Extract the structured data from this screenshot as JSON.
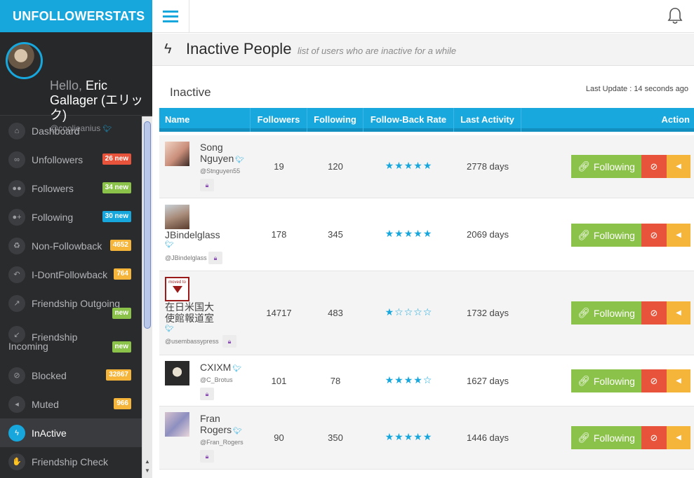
{
  "brand": "UNFOLLOWERSTATS",
  "colors": {
    "accent": "#17a7dc",
    "sidebar": "#2a2b2d",
    "follow": "#8bc34a",
    "block": "#e8543b",
    "mute": "#f5b43a"
  },
  "profile": {
    "hello": "Hello,",
    "name": "Eric Gallager (エリック)",
    "handle": "@cooljeanius"
  },
  "menu": [
    {
      "label": "Dashboard",
      "icon": "home-icon",
      "badge": "",
      "badge_color": ""
    },
    {
      "label": "Unfollowers",
      "icon": "unlink-icon",
      "badge": "26 new",
      "badge_color": "#e8543b"
    },
    {
      "label": "Followers",
      "icon": "users-icon",
      "badge": "34 new",
      "badge_color": "#8bc34a"
    },
    {
      "label": "Following",
      "icon": "user-plus-icon",
      "badge": "30 new",
      "badge_color": "#17a7dc"
    },
    {
      "label": "Non-Followback",
      "icon": "recycle-icon",
      "badge": "4652",
      "badge_color": "#f5b43a"
    },
    {
      "label": "I-DontFollowback",
      "icon": "reply-icon",
      "badge": "764",
      "badge_color": "#f5b43a"
    },
    {
      "label": "Friendship Outgoing",
      "icon": "outgoing-icon",
      "badge": "",
      "badge_color": ""
    },
    {
      "label": "Friendship",
      "label2": "Incoming",
      "icon": "incoming-icon",
      "badge": "new",
      "badge2": "new",
      "badge_color": "#8bc34a"
    },
    {
      "label": "Blocked",
      "icon": "ban-icon",
      "badge": "32867",
      "badge_color": "#f5b43a"
    },
    {
      "label": "Muted",
      "icon": "volume-off-icon",
      "badge": "966",
      "badge_color": "#f5b43a"
    },
    {
      "label": "InActive",
      "icon": "bolt-icon",
      "badge": "",
      "badge_color": ""
    },
    {
      "label": "Friendship Check",
      "icon": "handshake-icon",
      "badge": "",
      "badge_color": ""
    }
  ],
  "page": {
    "title": "Inactive People",
    "subtitle": "list of users who are inactive for a while"
  },
  "panel": {
    "title": "Inactive",
    "last_update": "Last Update : 14 seconds ago"
  },
  "table": {
    "headers": {
      "name": "Name",
      "followers": "Followers",
      "following": "Following",
      "rate": "Follow-Back Rate",
      "activity": "Last Activity",
      "action": "Action"
    },
    "rows": [
      {
        "name": "Song Nguyen",
        "handle": "@Stnguyen55",
        "followers": "19",
        "following": "120",
        "rating": 5,
        "stars": "★★★★★",
        "activity": "2778 days",
        "follow_label": "Following"
      },
      {
        "name": "JBindelglass",
        "handle": "@JBindelglass",
        "followers": "178",
        "following": "345",
        "rating": 5,
        "stars": "★★★★★",
        "activity": "2069 days",
        "follow_label": "Following"
      },
      {
        "name": "在日米国大使館報道室",
        "handle": "@usembassypress",
        "followers": "14717",
        "following": "483",
        "rating": 1,
        "stars": "★☆☆☆☆",
        "activity": "1732 days",
        "follow_label": "Following",
        "avatar_text": "moved to"
      },
      {
        "name": "CXIXM",
        "handle": "@C_Brotus",
        "followers": "101",
        "following": "78",
        "rating": 4,
        "stars": "★★★★☆",
        "activity": "1627 days",
        "follow_label": "Following"
      },
      {
        "name": "Fran Rogers",
        "handle": "@Fran_Rogers",
        "followers": "90",
        "following": "350",
        "rating": 5,
        "stars": "★★★★★",
        "activity": "1446 days",
        "follow_label": "Following"
      }
    ]
  }
}
